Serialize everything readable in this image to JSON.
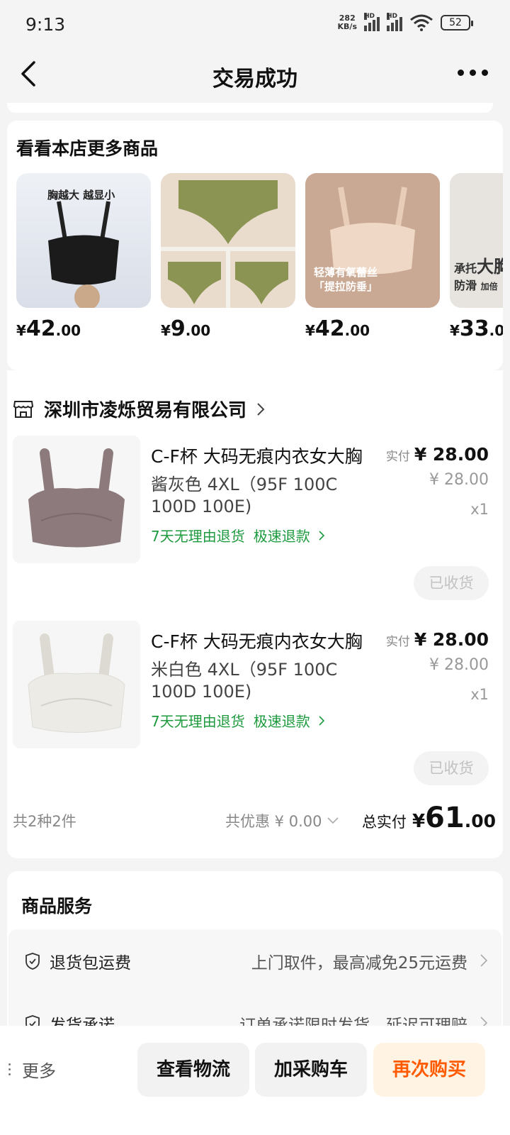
{
  "status_bar": {
    "time": "9:13",
    "net_speed_value": "282",
    "net_speed_unit": "KB/s",
    "signal_label": "HD",
    "battery": "52"
  },
  "nav": {
    "title": "交易成功"
  },
  "more_products": {
    "title": "看看本店更多商品",
    "items": [
      {
        "currency": "¥",
        "price_int": "42",
        "price_dec": ".00",
        "img_caption": "胸越大 越显小"
      },
      {
        "currency": "¥",
        "price_int": "9",
        "price_dec": ".00"
      },
      {
        "currency": "¥",
        "price_int": "42",
        "price_dec": ".00",
        "img_caption_1": "轻薄有氧蕾丝",
        "img_caption_2": "「提拉防垂」"
      },
      {
        "currency": "¥",
        "price_int": "33",
        "price_dec": ".0",
        "img_caption_1": "承托",
        "img_caption_big": "大胸",
        "img_caption_2": "防滑",
        "img_caption_3": "加倍"
      }
    ]
  },
  "order": {
    "shop_name": "深圳市凌烁贸易有限公司",
    "items": [
      {
        "title": "C-F杯 大码无痕内衣女大胸",
        "spec": "酱灰色 4XL（95F 100C 100D 100E)",
        "service_1": "7天无理由退货",
        "service_2": "极速退款",
        "paid_label": "实付",
        "paid_value": "¥ 28.00",
        "orig_price": "¥ 28.00",
        "qty": "x1",
        "status_button": "已收货",
        "color": "#8c7a7c"
      },
      {
        "title": "C-F杯 大码无痕内衣女大胸",
        "spec": "米白色 4XL（95F 100C 100D 100E)",
        "service_1": "7天无理由退货",
        "service_2": "极速退款",
        "paid_label": "实付",
        "paid_value": "¥ 28.00",
        "orig_price": "¥ 28.00",
        "qty": "x1",
        "status_button": "已收货",
        "color": "#ecebe6"
      }
    ],
    "summary": {
      "count": "共2种2件",
      "discount": "共优惠 ¥ 0.00",
      "total_label": "总实付",
      "total_currency": "¥",
      "total_int": "61",
      "total_dec": ".00"
    }
  },
  "services": {
    "title": "商品服务",
    "rows": [
      {
        "name": "退货包运费",
        "desc": "上门取件，最高减免25元运费"
      },
      {
        "name": "发货承诺",
        "desc": "订单承诺限时发货，延迟可理赔"
      }
    ]
  },
  "bottom_bar": {
    "more": "更多",
    "logistics": "查看物流",
    "add_cart": "加采购车",
    "buy_again": "再次购买"
  },
  "colors": {
    "accent": "#ff5a00",
    "service_green": "#1e9a3f"
  }
}
